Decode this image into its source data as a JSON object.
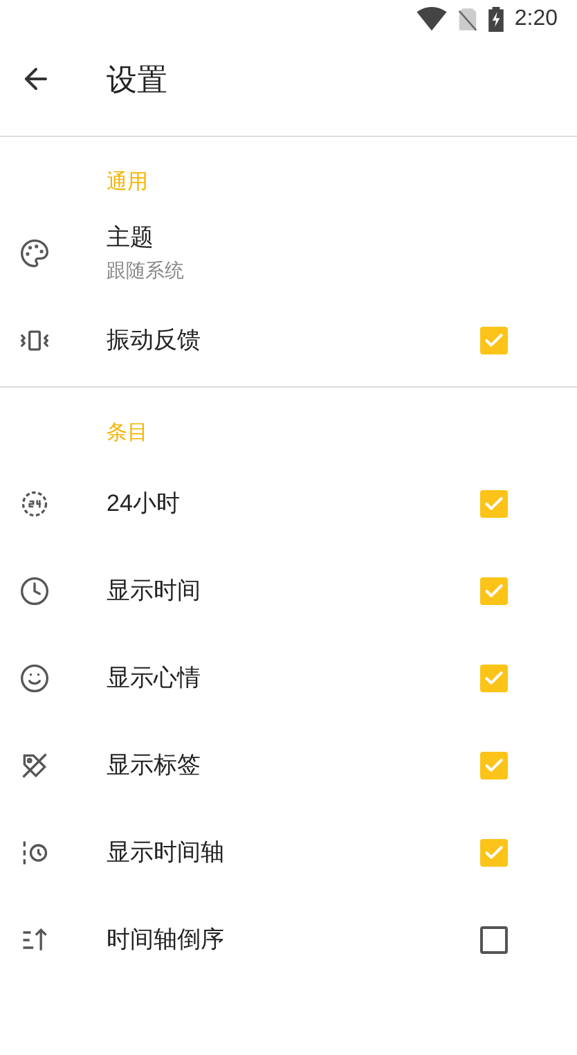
{
  "status_bar": {
    "time": "2:20"
  },
  "header": {
    "title": "设置"
  },
  "sections": [
    {
      "title": "通用",
      "items": [
        {
          "kind": "choice",
          "label": "主题",
          "value": "跟随系统"
        },
        {
          "kind": "checkbox",
          "label": "振动反馈",
          "checked": true
        }
      ]
    },
    {
      "title": "条目",
      "items": [
        {
          "kind": "checkbox",
          "label": "24小时",
          "checked": true
        },
        {
          "kind": "checkbox",
          "label": "显示时间",
          "checked": true
        },
        {
          "kind": "checkbox",
          "label": "显示心情",
          "checked": true
        },
        {
          "kind": "checkbox",
          "label": "显示标签",
          "checked": true
        },
        {
          "kind": "checkbox",
          "label": "显示时间轴",
          "checked": true
        },
        {
          "kind": "checkbox",
          "label": "时间轴倒序",
          "checked": false
        }
      ]
    }
  ]
}
